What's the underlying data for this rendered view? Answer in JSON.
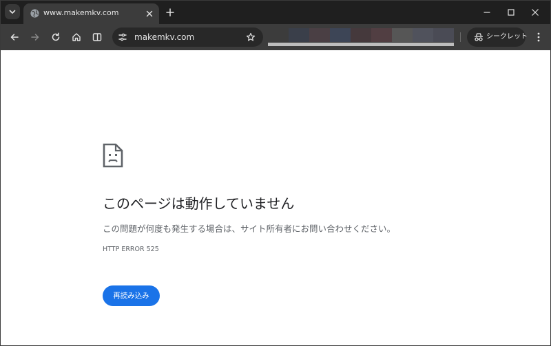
{
  "browser": {
    "tab": {
      "title": "www.makemkv.com",
      "favicon": "globe-icon"
    },
    "toolbar": {
      "url": "makemkv.com",
      "incognito_label": "シークレット"
    },
    "colors": {
      "tabstrip_bg": "#1f1f1f",
      "toolbar_bg": "#3c3c3c",
      "omnibox_bg": "#282828"
    },
    "redacted_bookmarks": [
      "#3c3c3c",
      "#3a3f4a",
      "#4a3f44",
      "#3d4556",
      "#45393c",
      "#513e42",
      "#565656",
      "#50525c",
      "#4a4b55"
    ]
  },
  "error_page": {
    "icon": "sad-page-icon",
    "title": "このページは動作していません",
    "description": "この問題が何度も発生する場合は、サイト所有者にお問い合わせください。",
    "error_code": "HTTP ERROR 525",
    "reload_label": "再読み込み",
    "accent_color": "#1a73e8"
  }
}
